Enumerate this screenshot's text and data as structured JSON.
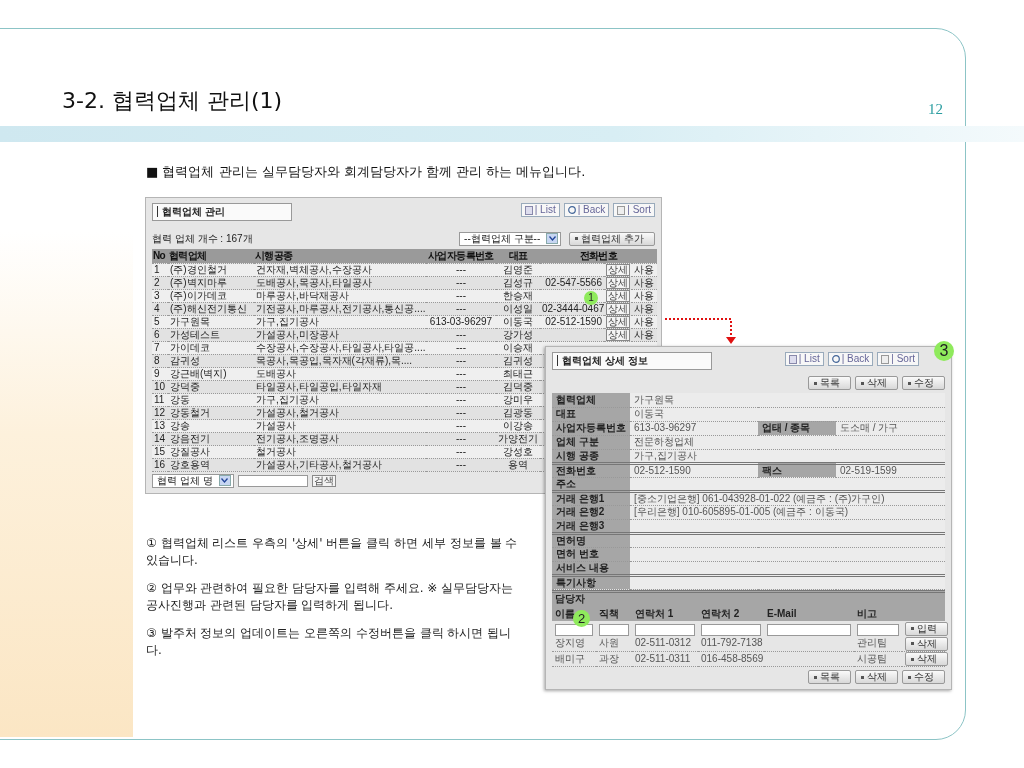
{
  "slide": {
    "title": "3-2. 협력업체 관리(1)",
    "page_number": "12",
    "intro": "■ 협력업체 관리는 실무담당자와 회계담당자가 함께 관리 하는 메뉴입니다."
  },
  "list_screen": {
    "title": "협력업체 관리",
    "toolbar": [
      {
        "kind": "list",
        "label": "| List"
      },
      {
        "kind": "back",
        "label": "| Back"
      },
      {
        "kind": "sort",
        "label": "| Sort"
      }
    ],
    "count": "협력 업체 개수 : 167개",
    "category_select": "--협력업체 구분--",
    "add_button": "협력업체 추가",
    "columns": [
      "No",
      "협력업체",
      "시행공종",
      "사업자등록번호",
      "대표",
      "전화번호"
    ],
    "rows": [
      {
        "no": "1",
        "company": "(주)경인철거",
        "work": "건자재,벽체공사,수장공사",
        "reg_no": "---",
        "ceo": "김영준",
        "detail_button": "상세",
        "status": "사용"
      },
      {
        "no": "2",
        "company": "(주)벽지마루",
        "work": "도배공사,목공사,타일공사",
        "reg_no": "---",
        "ceo": "김성규",
        "phone": "02-547-5566",
        "detail_button": "상세",
        "status": "사용"
      },
      {
        "no": "3",
        "company": "(주)이가데코",
        "work": "마루공사,바닥재공사",
        "reg_no": "---",
        "ceo": "한승재",
        "detail_button": "상세",
        "status": "사용"
      },
      {
        "no": "4",
        "company": "(주)해신전기통신",
        "work": "기전공사,마루공사,전기공사,통신공....",
        "reg_no": "---",
        "ceo": "이성일",
        "phone": "02-3444-0467",
        "detail_button": "상세",
        "status": "사용"
      },
      {
        "no": "5",
        "company": "가구원목",
        "work": "가구,집기공사",
        "reg_no": "613-03-96297",
        "ceo": "이동국",
        "phone": "02-512-1590",
        "detail_button": "상세",
        "status": "사용"
      },
      {
        "no": "6",
        "company": "가성테스트",
        "work": "가설공사,미장공사",
        "reg_no": "---",
        "ceo": "강가성",
        "detail_button": "상세",
        "status": "사용"
      },
      {
        "no": "7",
        "company": "가이데코",
        "work": "수장공사,수장공사,타일공사,타일공....",
        "reg_no": "---",
        "ceo": "이승재"
      },
      {
        "no": "8",
        "company": "감귀성",
        "work": "목공사,목공입,목자재(각재류),목....",
        "reg_no": "---",
        "ceo": "김귀성"
      },
      {
        "no": "9",
        "company": "강근배(벽지)",
        "work": "도배공사",
        "reg_no": "---",
        "ceo": "최태근"
      },
      {
        "no": "10",
        "company": "강덕중",
        "work": "타일공사,타일공입,타일자재",
        "reg_no": "---",
        "ceo": "김덕중"
      },
      {
        "no": "11",
        "company": "강동",
        "work": "가구,집기공사",
        "reg_no": "---",
        "ceo": "강미우"
      },
      {
        "no": "12",
        "company": "강동철거",
        "work": "가설공사,철거공사",
        "reg_no": "---",
        "ceo": "김광동"
      },
      {
        "no": "13",
        "company": "강송",
        "work": "가설공사",
        "reg_no": "---",
        "ceo": "이강송"
      },
      {
        "no": "14",
        "company": "강음전기",
        "work": "전기공사,조명공사",
        "reg_no": "---",
        "ceo": "가양전기"
      },
      {
        "no": "15",
        "company": "강질공사",
        "work": "철거공사",
        "reg_no": "---",
        "ceo": "강성호"
      },
      {
        "no": "16",
        "company": "강호용역",
        "work": "가설공사,기타공사,철거공사",
        "reg_no": "---",
        "ceo": "용역"
      }
    ],
    "search": {
      "select": "협력 업체 명",
      "button": "검색"
    }
  },
  "detail_screen": {
    "title": "협력업체 상세 정보",
    "toolbar": [
      {
        "kind": "list",
        "label": "| List"
      },
      {
        "kind": "back",
        "label": "| Back"
      },
      {
        "kind": "sort",
        "label": "| Sort"
      }
    ],
    "top_buttons": [
      "목록",
      "삭제",
      "수정"
    ],
    "sections": [
      [
        {
          "label": "협력업체",
          "value": "가구원목"
        },
        {
          "label": "대표",
          "value": "이동국"
        },
        {
          "label": "사업자등록번호",
          "value": "613-03-96297",
          "label_2": "업태 / 종목",
          "value_2": "도소매 / 가구"
        },
        {
          "label": "업체 구분",
          "value": "전문하청업체"
        },
        {
          "label": "시행 공종",
          "value": "가구,집기공사"
        }
      ],
      [
        {
          "label": "전화번호",
          "value": "02-512-1590",
          "label_2": "팩스",
          "value_2": "02-519-1599"
        },
        {
          "label": "주소"
        }
      ],
      [
        {
          "label": "거래 은행1",
          "value": "[중소기업은행] 061-043928-01-022 (예금주 : (주)가구인)"
        },
        {
          "label": "거래 은행2",
          "value": "[우리은행] 010-605895-01-005 (예금주 : 이동국)"
        },
        {
          "label": "거래 은행3"
        }
      ],
      [
        {
          "label": "면허명"
        },
        {
          "label": "면허 번호"
        },
        {
          "label": "서비스 내용"
        }
      ],
      [
        {
          "label": "특기사항"
        }
      ]
    ],
    "contacts": {
      "title": "담당자",
      "columns": [
        "이름",
        "직책",
        "연락처 1",
        "연락처 2",
        "E-Mail",
        "비고"
      ],
      "input_button": "입력",
      "rows": [
        {
          "name": "장지영",
          "position": "사원",
          "phone_1": "02-511-0312",
          "phone_2": "011-792-7138",
          "note": "관리팀",
          "button": "삭제"
        },
        {
          "name": "배미구",
          "position": "과장",
          "phone_1": "02-511-0311",
          "phone_2": "016-458-8569",
          "note": "시공팀",
          "button": "삭제"
        }
      ]
    },
    "bottom_buttons": [
      "목록",
      "삭제",
      "수정"
    ]
  },
  "callouts": [
    "1",
    "2",
    "3"
  ],
  "notes": [
    "① 협력업체 리스트 우측의 '상세' 버튼을 클릭 하면 세부 정보를 볼 수 있습니다.",
    "② 업무와 관련하여 필요한 담당자를 입력해 주세요. ※ 실무담당자는 공사진행과 관련된 담당자를 입력하게 됩니다.",
    "③ 발주처 정보의 업데이트는 오른쪽의 수정버튼을 클릭 하시면 됩니다."
  ]
}
